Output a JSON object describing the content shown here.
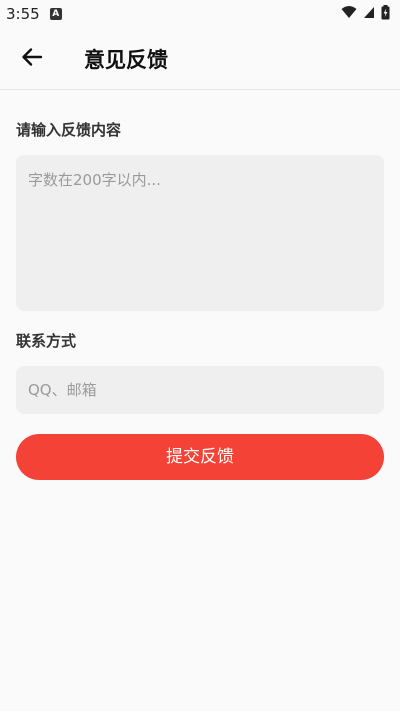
{
  "status_bar": {
    "time": "3:55",
    "notification_badge": "A",
    "icons": [
      "wifi-icon",
      "cellular-signal-icon",
      "battery-icon"
    ]
  },
  "app_bar": {
    "back_icon": "arrow-left-icon",
    "title": "意见反馈"
  },
  "form": {
    "content_label": "请输入反馈内容",
    "content_placeholder": "字数在200字以内...",
    "contact_label": "联系方式",
    "contact_placeholder": "QQ、邮箱",
    "submit_label": "提交反馈"
  },
  "colors": {
    "accent": "#f44336",
    "background": "#fafafa",
    "field_background": "#efefef",
    "placeholder_text": "#9a9a9a"
  }
}
